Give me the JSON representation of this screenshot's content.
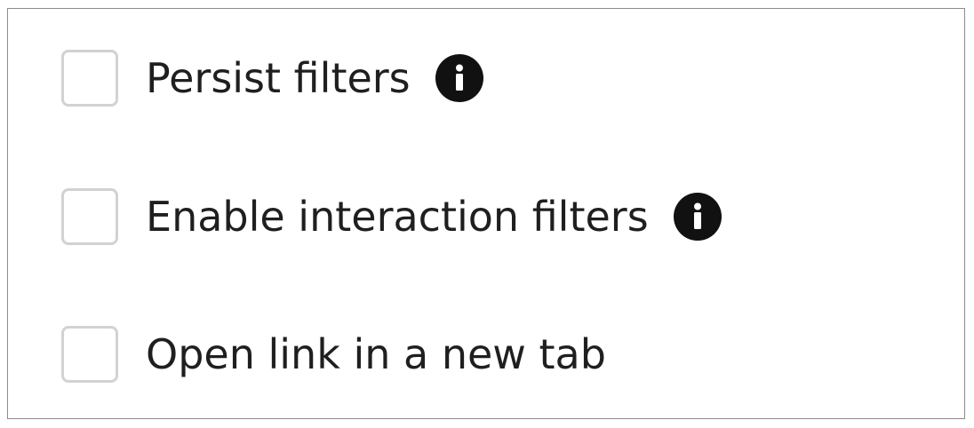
{
  "options": [
    {
      "label": "Persist filters",
      "checked": false,
      "has_info": true,
      "info_icon": "info-icon"
    },
    {
      "label": "Enable interaction filters",
      "checked": false,
      "has_info": true,
      "info_icon": "info-icon"
    },
    {
      "label": "Open link in a new tab",
      "checked": false,
      "has_info": false
    }
  ],
  "colors": {
    "text": "#1f1f1f",
    "checkbox_border": "#d2d2d2",
    "info_icon_bg": "#111111",
    "panel_border": "#8c8c8c"
  }
}
